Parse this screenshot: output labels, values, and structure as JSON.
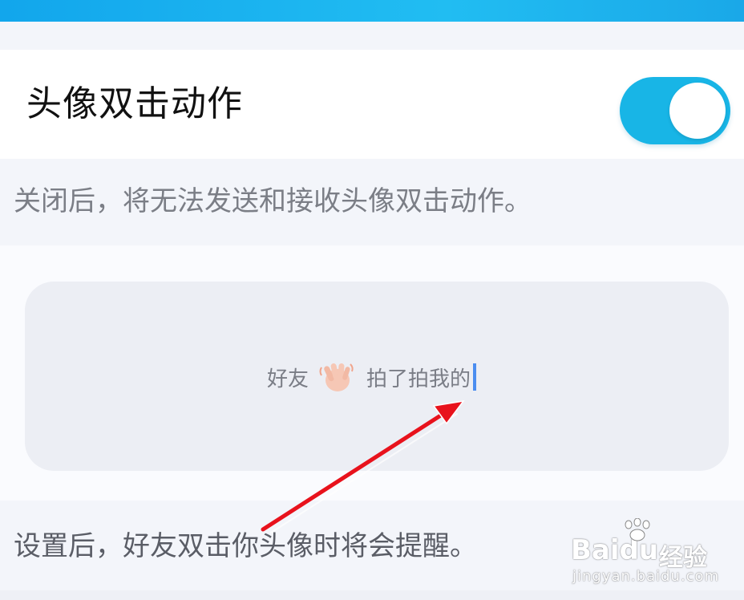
{
  "setting": {
    "title": "头像双击动作",
    "toggle_on": true,
    "description": "关闭后，将无法发送和接收头像双击动作。"
  },
  "preview": {
    "friend": "好友",
    "action_icon": "waving-hand-icon",
    "message": "拍了拍我的"
  },
  "footer": {
    "note": "设置后，好友双击你头像时将会提醒。"
  },
  "watermark": {
    "brand": "Baidu",
    "label": "经验",
    "url": "jingyan.baidu.com"
  },
  "colors": {
    "accent": "#18b5e6",
    "header": "#12a6ec",
    "annotation_arrow": "#e8121c",
    "cursor": "#4b8df0"
  }
}
